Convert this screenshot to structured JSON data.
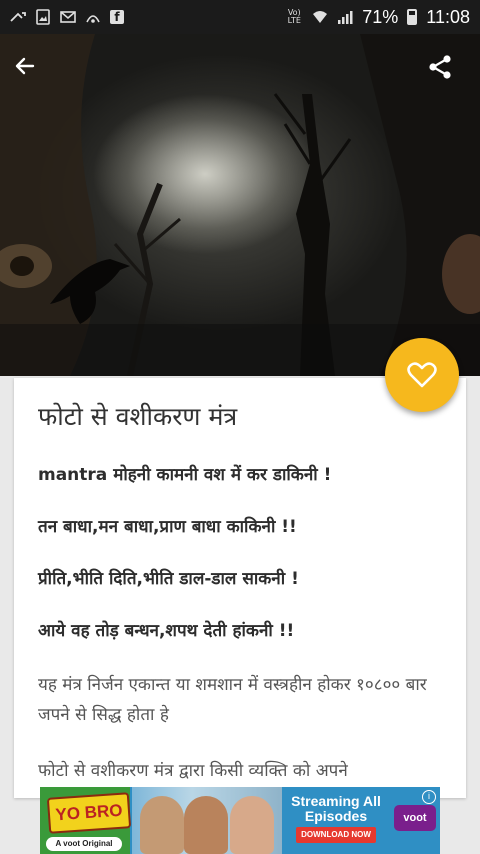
{
  "status_bar": {
    "battery": "71%",
    "time": "11:08",
    "network_label": "Vo) LTE",
    "notification_icons": [
      "missed-call-icon",
      "gallery-icon",
      "mail-icon",
      "hotspot-icon",
      "facebook-icon"
    ],
    "system_icons": [
      "wifi-icon",
      "signal-icon",
      "battery-icon"
    ]
  },
  "toolbar": {
    "back_icon": "arrow-back-icon",
    "share_icon": "share-icon"
  },
  "fab": {
    "icon": "heart-outline-icon",
    "color": "#f6b81d"
  },
  "article": {
    "title": "फोटो से वशीकरण मंत्र",
    "mantra_lines": [
      "mantra  मोहनी कामनी वश में कर डाकिनी !",
      "तन बाधा,मन बाधा,प्राण बाधा काकिनी !!",
      "प्रीति,भीति दिति,भीति डाल-डाल साकनी !",
      "आये वह तोड़ बन्धन,शपथ देती हांकनी !!"
    ],
    "paragraphs": [
      "यह मंत्र निर्जन एकान्त या शमशान में वस्त्रहीन होकर १०८०० बार जपने से सिद्ध होता हे",
      "फोटो से वशीकरण मंत्र द्वारा किसी व्यक्ति को अपने"
    ]
  },
  "ad": {
    "logo_text": "YO BRO",
    "tag_text": "A voot Original",
    "heading": "Streaming All Episodes",
    "cta": "DOWNLOAD NOW",
    "brand": "voot",
    "info_icon": "info-icon"
  }
}
